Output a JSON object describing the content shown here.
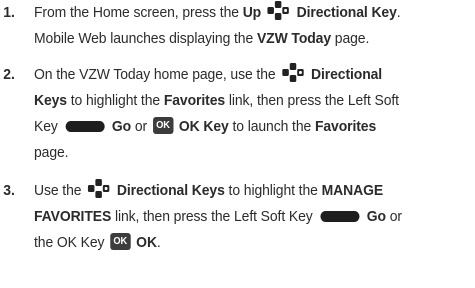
{
  "steps": [
    {
      "number": "1.",
      "l1": "From the Home screen, press the",
      "l1_b1": "Up",
      "l1_b2": "Directional Key",
      "l1_end": ".",
      "l2_a": "Mobile Web launches displaying the",
      "l2_b": "VZW Today",
      "l2_c": "page."
    },
    {
      "number": "2.",
      "l1": "On the VZW Today home page, use the",
      "l1_b": "Directional",
      "l2_b": "Keys",
      "l2_a": "to highlight the",
      "l2_b2": "Favorites",
      "l2_c": "link, then press the Left Soft",
      "l3_a": "Key",
      "l3_b": "Go",
      "l3_c": "or",
      "l3_ok": "OK",
      "l3_d": "OK Key",
      "l3_e": "to launch the",
      "l3_f": "Favorites",
      "l4": "page."
    },
    {
      "number": "3.",
      "l1_a": "Use the",
      "l1_b": "Directional Keys",
      "l1_c": "to highlight the",
      "l1_d": "MANAGE",
      "l2_a": "FAVORITES",
      "l2_b": "link, then press the Left Soft Key",
      "l2_c": "Go",
      "l2_d": "or",
      "l3_a": "the OK Key",
      "l3_ok": "OK",
      "l3_b": "OK",
      "l3_end": "."
    }
  ],
  "icons": {
    "dpad": "directional-keypad-icon",
    "softkey": "left-soft-key-icon",
    "ok": "ok-key-icon"
  }
}
